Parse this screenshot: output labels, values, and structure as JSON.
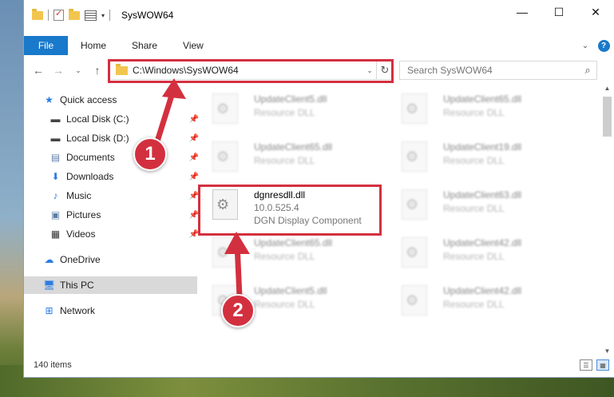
{
  "window": {
    "title": "SysWOW64",
    "minimize_glyph": "—",
    "maximize_glyph": "☐",
    "close_glyph": "✕"
  },
  "ribbon": {
    "file": "File",
    "tabs": [
      "Home",
      "Share",
      "View"
    ],
    "help_glyph": "?"
  },
  "address": {
    "path": "C:\\Windows\\SysWOW64",
    "search_placeholder": "Search SysWOW64"
  },
  "sidebar": {
    "items": [
      {
        "label": "Quick access",
        "icon": "star-icon",
        "pinned": false
      },
      {
        "label": "Local Disk (C:)",
        "icon": "drive-icon",
        "pinned": true
      },
      {
        "label": "Local Disk (D:)",
        "icon": "drive-icon",
        "pinned": true
      },
      {
        "label": "Documents",
        "icon": "documents-icon",
        "pinned": true
      },
      {
        "label": "Downloads",
        "icon": "download-icon",
        "pinned": true
      },
      {
        "label": "Music",
        "icon": "music-icon",
        "pinned": true
      },
      {
        "label": "Pictures",
        "icon": "pictures-icon",
        "pinned": true
      },
      {
        "label": "Videos",
        "icon": "videos-icon",
        "pinned": true
      },
      {
        "label": "OneDrive",
        "icon": "cloud-icon",
        "pinned": false
      },
      {
        "label": "This PC",
        "icon": "computer-icon",
        "pinned": false,
        "selected": true
      },
      {
        "label": "Network",
        "icon": "network-icon",
        "pinned": false
      }
    ]
  },
  "files": {
    "left": [
      {
        "name": "UpdateClient5.dll",
        "desc": "Resource DLL"
      },
      {
        "name": "UpdateClient65.dll",
        "desc": "Resource DLL"
      },
      {
        "name": "dgnresdll.dll",
        "version": "10.0.525.4",
        "desc": "DGN Display Component"
      },
      {
        "name": "UpdateClient65.dll",
        "desc": "Resource DLL"
      },
      {
        "name": "UpdateClient5.dll",
        "desc": "Resource DLL"
      }
    ],
    "right": [
      {
        "name": "UpdateClient65.dll",
        "desc": "Resource DLL"
      },
      {
        "name": "UpdateClient19.dll",
        "desc": "Resource DLL"
      },
      {
        "name": "UpdateClient63.dll",
        "desc": "Resource DLL"
      },
      {
        "name": "UpdateClient42.dll",
        "desc": "Resource DLL"
      },
      {
        "name": "UpdateClient42.dll",
        "desc": "Resource DLL"
      }
    ]
  },
  "status": {
    "count": "140 items"
  },
  "annotations": {
    "step1": "1",
    "step2": "2",
    "color": "#d3303f"
  }
}
